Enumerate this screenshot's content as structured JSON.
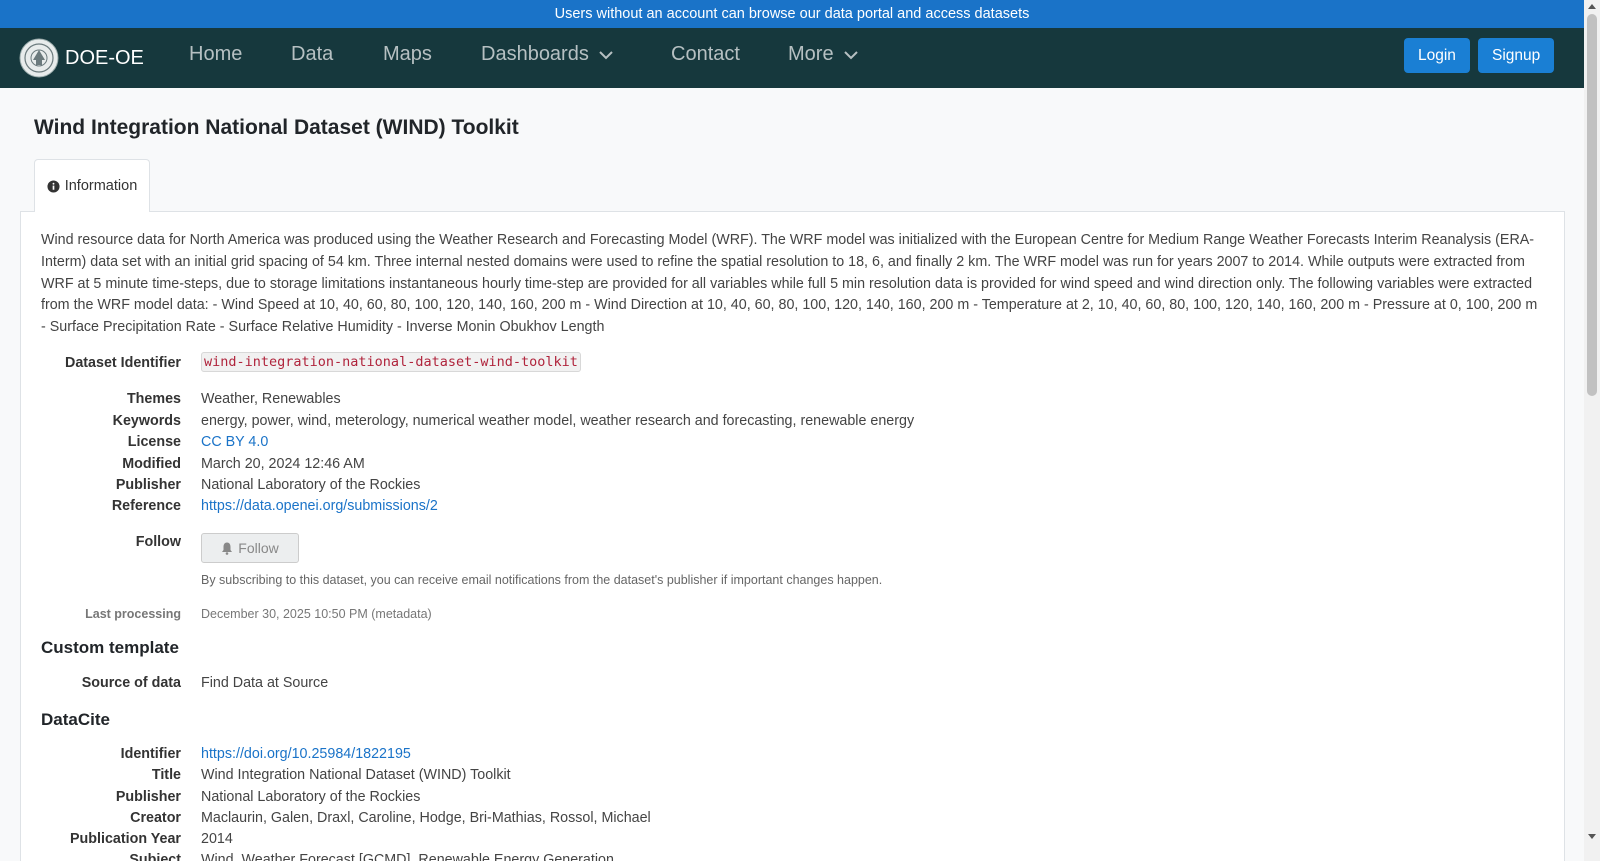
{
  "banner": {
    "text": "Users without an account can browse our data portal and access datasets"
  },
  "nav": {
    "brand": "DOE-OE",
    "items": [
      "Home",
      "Data",
      "Maps",
      "Dashboards",
      "Contact",
      "More"
    ],
    "login": "Login",
    "signup": "Signup"
  },
  "dataset": {
    "title": "Wind Integration National Dataset (WIND) Toolkit",
    "tab": "Information",
    "description": "Wind resource data for North America was produced using the Weather Research and Forecasting Model (WRF). The WRF model was initialized with the European Centre for Medium Range Weather Forecasts Interim Reanalysis (ERA-Interm) data set with an initial grid spacing of 54 km. Three internal nested domains were used to refine the spatial resolution to 18, 6, and finally 2 km. The WRF model was run for years 2007 to 2014. While outputs were extracted from WRF at 5 minute time-steps, due to storage limitations instantaneous hourly time-step are provided for all variables while full 5 min resolution data is provided for wind speed and wind direction only. The following variables were extracted from the WRF model data: - Wind Speed at 10, 40, 60, 80, 100, 120, 140, 160, 200 m - Wind Direction at 10, 40, 60, 80, 100, 120, 140, 160, 200 m - Temperature at 2, 10, 40, 60, 80, 100, 120, 140, 160, 200 m - Pressure at 0, 100, 200 m - Surface Precipitation Rate - Surface Relative Humidity - Inverse Monin Obukhov Length",
    "identifier_label": "Dataset Identifier",
    "identifier": "wind-integration-national-dataset-wind-toolkit",
    "fields": {
      "themes_label": "Themes",
      "themes": "Weather, Renewables",
      "keywords_label": "Keywords",
      "keywords": "energy, power, wind, meterology, numerical weather model, weather research and forecasting, renewable energy",
      "license_label": "License",
      "license": "CC BY 4.0",
      "modified_label": "Modified",
      "modified": "March 20, 2024 12:46 AM",
      "publisher_label": "Publisher",
      "publisher": "National Laboratory of the Rockies",
      "reference_label": "Reference",
      "reference": "https://data.openei.org/submissions/2"
    },
    "follow_label": "Follow",
    "follow_button": "Follow",
    "follow_help": "By subscribing to this dataset, you can receive email notifications from the dataset's publisher if important changes happen.",
    "last_processing_label": "Last processing",
    "last_processing": "December 30, 2025 10:50 PM (metadata)"
  },
  "custom_template": {
    "heading": "Custom template",
    "source_label": "Source of data",
    "source": "Find Data at Source"
  },
  "datacite": {
    "heading": "DataCite",
    "identifier_label": "Identifier",
    "identifier": "https://doi.org/10.25984/1822195",
    "title_label": "Title",
    "title": "Wind Integration National Dataset (WIND) Toolkit",
    "publisher_label": "Publisher",
    "publisher": "National Laboratory of the Rockies",
    "creator_label": "Creator",
    "creator": "Maclaurin, Galen, Draxl, Caroline, Hodge, Bri-Mathias, Rossol, Michael",
    "year_label": "Publication Year",
    "year": "2014",
    "subject_label": "Subject",
    "subject": "Wind, Weather Forecast [GCMD], Renewable Energy Generation"
  },
  "icons": {
    "seal": "doe-seal-icon",
    "caret": "chevron-down-icon",
    "info": "info-circle-icon",
    "bell": "bell-icon"
  },
  "colors": {
    "banner": "#1a73c8",
    "navbar": "#16383d",
    "accent": "#1a7fd4",
    "link": "#1a73c8",
    "code": "#b0243c"
  }
}
